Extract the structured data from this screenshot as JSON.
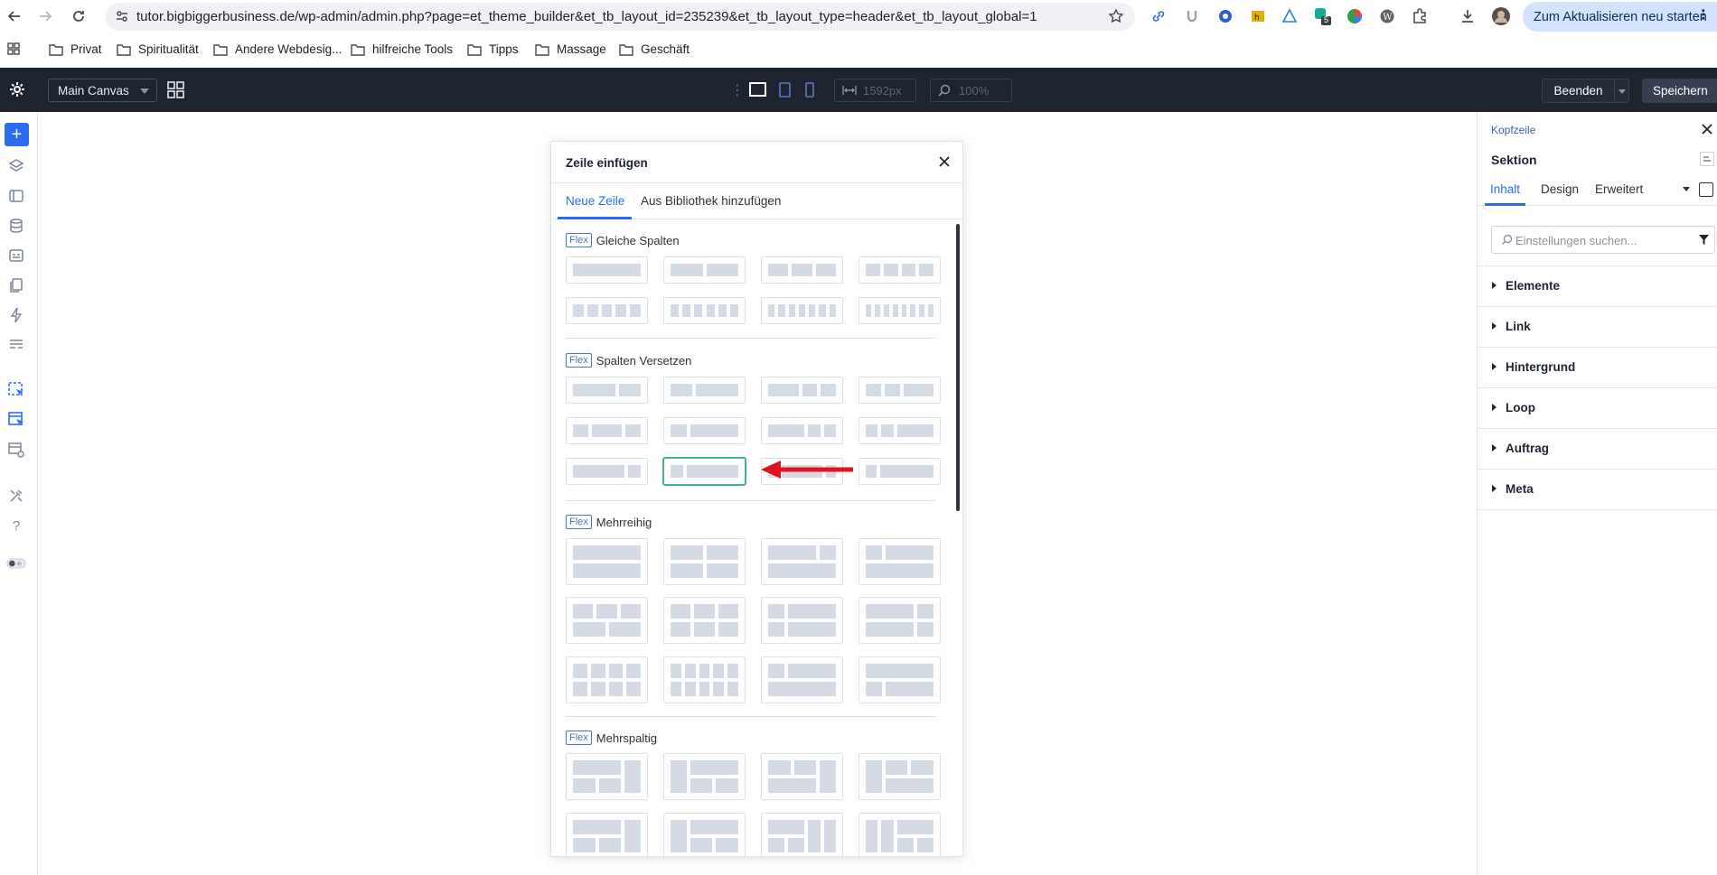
{
  "browser": {
    "url": "tutor.bigbiggerbusiness.de/wp-admin/admin.php?page=et_theme_builder&et_tb_layout_id=235239&et_tb_layout_type=header&et_tb_layout_global=1",
    "restart_label": "Zum Aktualisieren neu starten",
    "extension_badge": "5",
    "bookmarks": [
      "Privat",
      "Spiritualität",
      "Andere Webdesig...",
      "hilfreiche Tools",
      "Tipps",
      "Massage",
      "Geschäft"
    ]
  },
  "topbar": {
    "canvas_select": "Main Canvas",
    "width_value": "1592px",
    "zoom_value": "100%",
    "exit_label": "Beenden",
    "save_label": "Speichern"
  },
  "modal": {
    "title": "Zeile einfügen",
    "tabs": [
      "Neue Zeile",
      "Aus Bibliothek hinzufügen"
    ],
    "badge": "Flex",
    "sections": [
      "Gleiche Spalten",
      "Spalten Versetzen",
      "Mehrreihig",
      "Mehrspaltig"
    ]
  },
  "panel": {
    "breadcrumb": "Kopfzeile",
    "title": "Sektion",
    "tabs": [
      "Inhalt",
      "Design",
      "Erweitert"
    ],
    "search_placeholder": "Einstellungen suchen...",
    "groups": [
      "Elemente",
      "Link",
      "Hintergrund",
      "Loop",
      "Auftrag",
      "Meta"
    ]
  },
  "colors": {
    "accent": "#2b6cf1",
    "topbar": "#1d2430",
    "selected_border": "#45b58f",
    "arrow": "#e0141e"
  }
}
